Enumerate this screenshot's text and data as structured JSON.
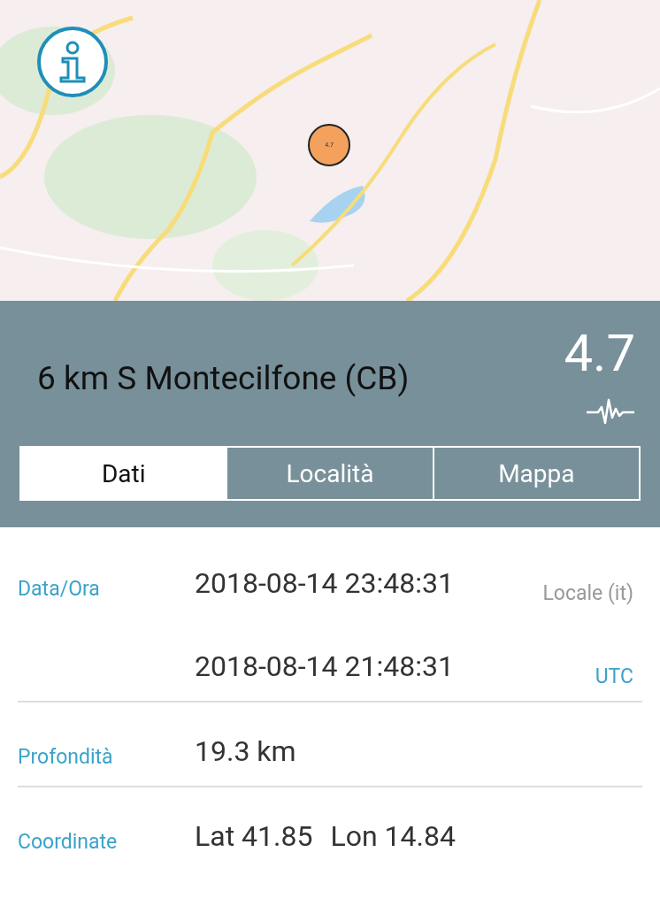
{
  "map": {
    "kind": "picture",
    "marker": {
      "label": "4.7",
      "color": "#f4a15d"
    }
  },
  "event": {
    "location": "6 km S Montecilfone (CB)",
    "magnitude": "4.7"
  },
  "tabs": [
    {
      "label": "Dati",
      "selected": true
    },
    {
      "label": "Località",
      "selected": false
    },
    {
      "label": "Mappa",
      "selected": false
    }
  ],
  "details": [
    {
      "label": "Data/Ora",
      "lines": [
        {
          "values": [
            "2018-08-14 23:48:31"
          ],
          "zone": "Locale (it)",
          "kind": "local"
        },
        {
          "values": [
            "2018-08-14 21:48:31"
          ],
          "zone": "UTC",
          "kind": "utc"
        }
      ]
    },
    {
      "label": "Profondità",
      "lines": [
        {
          "values": [
            "19.3 km"
          ]
        }
      ]
    },
    {
      "label": "Coordinate",
      "lines": [
        {
          "values": [
            "Lat 41.85",
            "Lon 14.84"
          ]
        }
      ]
    }
  ]
}
